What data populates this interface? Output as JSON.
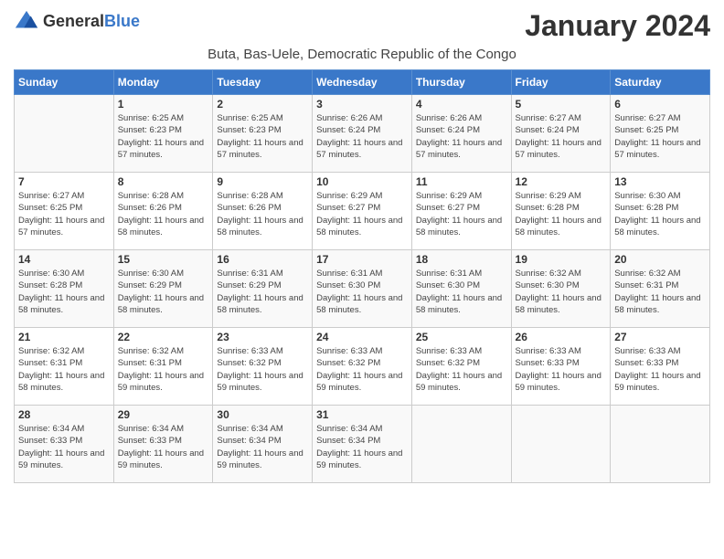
{
  "header": {
    "logo_general": "General",
    "logo_blue": "Blue",
    "month_title": "January 2024",
    "location": "Buta, Bas-Uele, Democratic Republic of the Congo"
  },
  "weekdays": [
    "Sunday",
    "Monday",
    "Tuesday",
    "Wednesday",
    "Thursday",
    "Friday",
    "Saturday"
  ],
  "weeks": [
    [
      {
        "day": "",
        "info": ""
      },
      {
        "day": "1",
        "info": "Sunrise: 6:25 AM\nSunset: 6:23 PM\nDaylight: 11 hours and 57 minutes."
      },
      {
        "day": "2",
        "info": "Sunrise: 6:25 AM\nSunset: 6:23 PM\nDaylight: 11 hours and 57 minutes."
      },
      {
        "day": "3",
        "info": "Sunrise: 6:26 AM\nSunset: 6:24 PM\nDaylight: 11 hours and 57 minutes."
      },
      {
        "day": "4",
        "info": "Sunrise: 6:26 AM\nSunset: 6:24 PM\nDaylight: 11 hours and 57 minutes."
      },
      {
        "day": "5",
        "info": "Sunrise: 6:27 AM\nSunset: 6:24 PM\nDaylight: 11 hours and 57 minutes."
      },
      {
        "day": "6",
        "info": "Sunrise: 6:27 AM\nSunset: 6:25 PM\nDaylight: 11 hours and 57 minutes."
      }
    ],
    [
      {
        "day": "7",
        "info": "Sunrise: 6:27 AM\nSunset: 6:25 PM\nDaylight: 11 hours and 57 minutes."
      },
      {
        "day": "8",
        "info": "Sunrise: 6:28 AM\nSunset: 6:26 PM\nDaylight: 11 hours and 58 minutes."
      },
      {
        "day": "9",
        "info": "Sunrise: 6:28 AM\nSunset: 6:26 PM\nDaylight: 11 hours and 58 minutes."
      },
      {
        "day": "10",
        "info": "Sunrise: 6:29 AM\nSunset: 6:27 PM\nDaylight: 11 hours and 58 minutes."
      },
      {
        "day": "11",
        "info": "Sunrise: 6:29 AM\nSunset: 6:27 PM\nDaylight: 11 hours and 58 minutes."
      },
      {
        "day": "12",
        "info": "Sunrise: 6:29 AM\nSunset: 6:28 PM\nDaylight: 11 hours and 58 minutes."
      },
      {
        "day": "13",
        "info": "Sunrise: 6:30 AM\nSunset: 6:28 PM\nDaylight: 11 hours and 58 minutes."
      }
    ],
    [
      {
        "day": "14",
        "info": "Sunrise: 6:30 AM\nSunset: 6:28 PM\nDaylight: 11 hours and 58 minutes."
      },
      {
        "day": "15",
        "info": "Sunrise: 6:30 AM\nSunset: 6:29 PM\nDaylight: 11 hours and 58 minutes."
      },
      {
        "day": "16",
        "info": "Sunrise: 6:31 AM\nSunset: 6:29 PM\nDaylight: 11 hours and 58 minutes."
      },
      {
        "day": "17",
        "info": "Sunrise: 6:31 AM\nSunset: 6:30 PM\nDaylight: 11 hours and 58 minutes."
      },
      {
        "day": "18",
        "info": "Sunrise: 6:31 AM\nSunset: 6:30 PM\nDaylight: 11 hours and 58 minutes."
      },
      {
        "day": "19",
        "info": "Sunrise: 6:32 AM\nSunset: 6:30 PM\nDaylight: 11 hours and 58 minutes."
      },
      {
        "day": "20",
        "info": "Sunrise: 6:32 AM\nSunset: 6:31 PM\nDaylight: 11 hours and 58 minutes."
      }
    ],
    [
      {
        "day": "21",
        "info": "Sunrise: 6:32 AM\nSunset: 6:31 PM\nDaylight: 11 hours and 58 minutes."
      },
      {
        "day": "22",
        "info": "Sunrise: 6:32 AM\nSunset: 6:31 PM\nDaylight: 11 hours and 59 minutes."
      },
      {
        "day": "23",
        "info": "Sunrise: 6:33 AM\nSunset: 6:32 PM\nDaylight: 11 hours and 59 minutes."
      },
      {
        "day": "24",
        "info": "Sunrise: 6:33 AM\nSunset: 6:32 PM\nDaylight: 11 hours and 59 minutes."
      },
      {
        "day": "25",
        "info": "Sunrise: 6:33 AM\nSunset: 6:32 PM\nDaylight: 11 hours and 59 minutes."
      },
      {
        "day": "26",
        "info": "Sunrise: 6:33 AM\nSunset: 6:33 PM\nDaylight: 11 hours and 59 minutes."
      },
      {
        "day": "27",
        "info": "Sunrise: 6:33 AM\nSunset: 6:33 PM\nDaylight: 11 hours and 59 minutes."
      }
    ],
    [
      {
        "day": "28",
        "info": "Sunrise: 6:34 AM\nSunset: 6:33 PM\nDaylight: 11 hours and 59 minutes."
      },
      {
        "day": "29",
        "info": "Sunrise: 6:34 AM\nSunset: 6:33 PM\nDaylight: 11 hours and 59 minutes."
      },
      {
        "day": "30",
        "info": "Sunrise: 6:34 AM\nSunset: 6:34 PM\nDaylight: 11 hours and 59 minutes."
      },
      {
        "day": "31",
        "info": "Sunrise: 6:34 AM\nSunset: 6:34 PM\nDaylight: 11 hours and 59 minutes."
      },
      {
        "day": "",
        "info": ""
      },
      {
        "day": "",
        "info": ""
      },
      {
        "day": "",
        "info": ""
      }
    ]
  ]
}
